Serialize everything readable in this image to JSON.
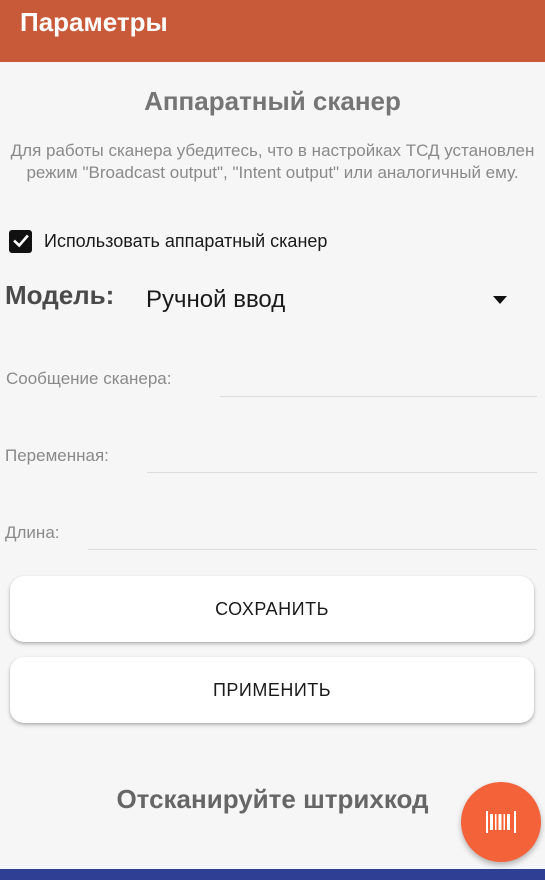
{
  "appbar": {
    "title": "Параметры"
  },
  "scanner": {
    "title": "Аппаратный сканер",
    "hint": "Для работы сканера убедитесь, что в настройках ТСД установлен режим \"Broadcast output\", \"Intent output\" или аналогичный ему.",
    "use_hardware_label": "Использовать аппаратный сканер",
    "use_hardware_checked": true
  },
  "model": {
    "label": "Модель:",
    "value": "Ручной ввод"
  },
  "fields": {
    "scanner_message": {
      "label": "Сообщение сканера:",
      "value": ""
    },
    "variable": {
      "label": "Переменная:",
      "value": ""
    },
    "length": {
      "label": "Длина:",
      "value": ""
    }
  },
  "buttons": {
    "save": "СОХРАНИТЬ",
    "apply": "ПРИМЕНИТЬ"
  },
  "scan_prompt": "Отсканируйте штрихкод",
  "fab": {
    "icon": "barcode-icon"
  },
  "colors": {
    "appbar": "#c85a3a",
    "fab": "#f4623a",
    "navbar": "#2f3f94",
    "background": "#f6f6f6"
  }
}
